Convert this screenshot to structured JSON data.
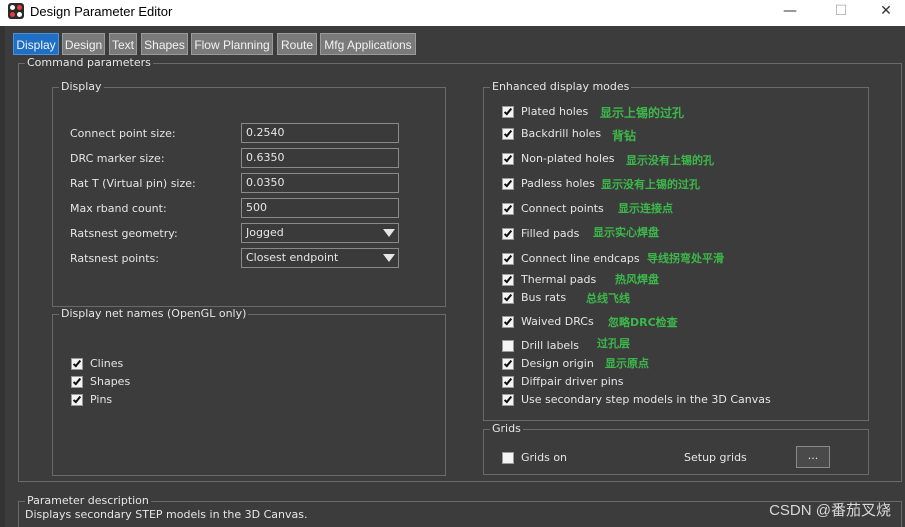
{
  "window": {
    "title": "Design Parameter Editor",
    "controls": {
      "minimize": "—",
      "maximize": "☐",
      "close": "✕"
    }
  },
  "tabs": [
    {
      "label": "Display",
      "active": true
    },
    {
      "label": "Design"
    },
    {
      "label": "Text"
    },
    {
      "label": "Shapes"
    },
    {
      "label": "Flow Planning"
    },
    {
      "label": "Route"
    },
    {
      "label": "Mfg Applications"
    }
  ],
  "command_parameters": {
    "title": "Command parameters",
    "display": {
      "title": "Display",
      "rows": [
        {
          "label": "Connect point size:",
          "value": "0.2540"
        },
        {
          "label": "DRC marker size:",
          "value": "0.6350"
        },
        {
          "label": "Rat T (Virtual pin) size:",
          "value": "0.0350"
        },
        {
          "label": "Max rband count:",
          "value": "500"
        },
        {
          "label": "Ratsnest geometry:",
          "value": "Jogged"
        },
        {
          "label": "Ratsnest points:",
          "value": "Closest endpoint"
        }
      ]
    },
    "net_names": {
      "title": "Display net names (OpenGL only)",
      "items": [
        {
          "label": "Clines",
          "checked": true
        },
        {
          "label": "Shapes",
          "checked": true
        },
        {
          "label": "Pins",
          "checked": true
        }
      ]
    },
    "enhanced": {
      "title": "Enhanced display modes",
      "items": [
        {
          "label": "Plated holes",
          "checked": true,
          "note": "显示上锡的过孔"
        },
        {
          "label": "Backdrill holes",
          "checked": true,
          "note": "背钻"
        },
        {
          "label": "Non-plated holes",
          "checked": true,
          "note": "显示没有上锡的孔"
        },
        {
          "label": "Padless holes",
          "checked": true,
          "note": "显示没有上锡的过孔"
        },
        {
          "label": "Connect points",
          "checked": true,
          "note": "显示连接点"
        },
        {
          "label": "Filled pads",
          "checked": true,
          "note": "显示实心焊盘"
        },
        {
          "label": "Connect line endcaps",
          "checked": true,
          "note": "导线拐弯处平滑"
        },
        {
          "label": "Thermal pads",
          "checked": true,
          "note": "热风焊盘"
        },
        {
          "label": "Bus rats",
          "checked": true,
          "note": "总线飞线"
        },
        {
          "label": "Waived DRCs",
          "checked": true,
          "note": "忽略DRC检查"
        },
        {
          "label": "Drill labels",
          "checked": false,
          "note": "过孔层"
        },
        {
          "label": "Design origin",
          "checked": true,
          "note": "显示原点"
        },
        {
          "label": "Diffpair driver pins",
          "checked": true,
          "note": ""
        },
        {
          "label": "Use secondary step models in the 3D Canvas",
          "checked": true,
          "note": ""
        }
      ]
    },
    "grids": {
      "title": "Grids",
      "grids_on_label": "Grids on",
      "grids_on_checked": false,
      "setup_label": "Setup grids",
      "setup_button": "..."
    }
  },
  "parameter_description": {
    "title": "Parameter description",
    "text": "Displays secondary STEP models in the 3D Canvas."
  },
  "watermark": "CSDN @番茄叉烧"
}
